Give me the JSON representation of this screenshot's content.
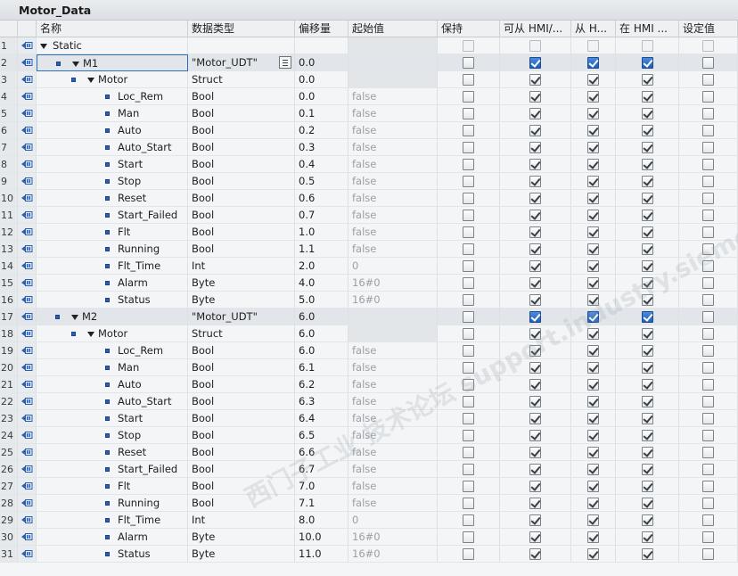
{
  "window": {
    "title": "Motor_Data"
  },
  "columns": [
    "名称",
    "数据类型",
    "偏移量",
    "起始值",
    "保持",
    "可从 HMI/...",
    "从 H...",
    "在 HMI ...",
    "设定值"
  ],
  "rows": [
    {
      "num": "1",
      "level": 0,
      "expand": true,
      "dot": false,
      "name": "Static",
      "type": "",
      "offset": "",
      "start": "",
      "hmi": "faded",
      "retain": "faded",
      "ellip": false
    },
    {
      "num": "2",
      "level": 1,
      "expand": true,
      "dot": true,
      "name": "M1",
      "type": "\"Motor_UDT\"",
      "offset": "0.0",
      "start": "",
      "hmi": "blue",
      "selected": true,
      "ellip": true
    },
    {
      "num": "3",
      "level": 2,
      "expand": true,
      "dot": true,
      "name": "Motor",
      "type": "Struct",
      "offset": "0.0",
      "start": "",
      "hmi": "on"
    },
    {
      "num": "4",
      "level": 3,
      "dot": true,
      "name": "Loc_Rem",
      "type": "Bool",
      "offset": "0.0",
      "start": "false",
      "hmi": "on"
    },
    {
      "num": "5",
      "level": 3,
      "dot": true,
      "name": "Man",
      "type": "Bool",
      "offset": "0.1",
      "start": "false",
      "hmi": "on"
    },
    {
      "num": "6",
      "level": 3,
      "dot": true,
      "name": "Auto",
      "type": "Bool",
      "offset": "0.2",
      "start": "false",
      "hmi": "on"
    },
    {
      "num": "7",
      "level": 3,
      "dot": true,
      "name": "Auto_Start",
      "type": "Bool",
      "offset": "0.3",
      "start": "false",
      "hmi": "on"
    },
    {
      "num": "8",
      "level": 3,
      "dot": true,
      "name": "Start",
      "type": "Bool",
      "offset": "0.4",
      "start": "false",
      "hmi": "on"
    },
    {
      "num": "9",
      "level": 3,
      "dot": true,
      "name": "Stop",
      "type": "Bool",
      "offset": "0.5",
      "start": "false",
      "hmi": "on"
    },
    {
      "num": "10",
      "level": 3,
      "dot": true,
      "name": "Reset",
      "type": "Bool",
      "offset": "0.6",
      "start": "false",
      "hmi": "on"
    },
    {
      "num": "11",
      "level": 3,
      "dot": true,
      "name": "Start_Failed",
      "type": "Bool",
      "offset": "0.7",
      "start": "false",
      "hmi": "on"
    },
    {
      "num": "12",
      "level": 3,
      "dot": true,
      "name": "Flt",
      "type": "Bool",
      "offset": "1.0",
      "start": "false",
      "hmi": "on"
    },
    {
      "num": "13",
      "level": 3,
      "dot": true,
      "name": "Running",
      "type": "Bool",
      "offset": "1.1",
      "start": "false",
      "hmi": "on"
    },
    {
      "num": "14",
      "level": 3,
      "dot": true,
      "name": "Flt_Time",
      "type": "Int",
      "offset": "2.0",
      "start": "0",
      "hmi": "on"
    },
    {
      "num": "15",
      "level": 3,
      "dot": true,
      "name": "Alarm",
      "type": "Byte",
      "offset": "4.0",
      "start": "16#0",
      "hmi": "on"
    },
    {
      "num": "16",
      "level": 3,
      "dot": true,
      "name": "Status",
      "type": "Byte",
      "offset": "5.0",
      "start": "16#0",
      "hmi": "on"
    },
    {
      "num": "17",
      "level": 1,
      "expand": true,
      "dot": true,
      "name": "M2",
      "type": "\"Motor_UDT\"",
      "offset": "6.0",
      "start": "",
      "hmi": "blue",
      "selected": true
    },
    {
      "num": "18",
      "level": 2,
      "expand": true,
      "dot": true,
      "name": "Motor",
      "type": "Struct",
      "offset": "6.0",
      "start": "",
      "hmi": "on"
    },
    {
      "num": "19",
      "level": 3,
      "dot": true,
      "name": "Loc_Rem",
      "type": "Bool",
      "offset": "6.0",
      "start": "false",
      "hmi": "on"
    },
    {
      "num": "20",
      "level": 3,
      "dot": true,
      "name": "Man",
      "type": "Bool",
      "offset": "6.1",
      "start": "false",
      "hmi": "on"
    },
    {
      "num": "21",
      "level": 3,
      "dot": true,
      "name": "Auto",
      "type": "Bool",
      "offset": "6.2",
      "start": "false",
      "hmi": "on"
    },
    {
      "num": "22",
      "level": 3,
      "dot": true,
      "name": "Auto_Start",
      "type": "Bool",
      "offset": "6.3",
      "start": "false",
      "hmi": "on"
    },
    {
      "num": "23",
      "level": 3,
      "dot": true,
      "name": "Start",
      "type": "Bool",
      "offset": "6.4",
      "start": "false",
      "hmi": "on"
    },
    {
      "num": "24",
      "level": 3,
      "dot": true,
      "name": "Stop",
      "type": "Bool",
      "offset": "6.5",
      "start": "false",
      "hmi": "on"
    },
    {
      "num": "25",
      "level": 3,
      "dot": true,
      "name": "Reset",
      "type": "Bool",
      "offset": "6.6",
      "start": "false",
      "hmi": "on"
    },
    {
      "num": "26",
      "level": 3,
      "dot": true,
      "name": "Start_Failed",
      "type": "Bool",
      "offset": "6.7",
      "start": "false",
      "hmi": "on"
    },
    {
      "num": "27",
      "level": 3,
      "dot": true,
      "name": "Flt",
      "type": "Bool",
      "offset": "7.0",
      "start": "false",
      "hmi": "on"
    },
    {
      "num": "28",
      "level": 3,
      "dot": true,
      "name": "Running",
      "type": "Bool",
      "offset": "7.1",
      "start": "false",
      "hmi": "on"
    },
    {
      "num": "29",
      "level": 3,
      "dot": true,
      "name": "Flt_Time",
      "type": "Int",
      "offset": "8.0",
      "start": "0",
      "hmi": "on"
    },
    {
      "num": "30",
      "level": 3,
      "dot": true,
      "name": "Alarm",
      "type": "Byte",
      "offset": "10.0",
      "start": "16#0",
      "hmi": "on"
    },
    {
      "num": "31",
      "level": 3,
      "dot": true,
      "name": "Status",
      "type": "Byte",
      "offset": "11.0",
      "start": "16#0",
      "hmi": "on"
    }
  ],
  "watermark": "西门子工业 技术论坛 support.industry.siemens.com/cs",
  "colors": {
    "checkbox_selected": "#1f5fb8",
    "start_value_text": "#9aa0a6",
    "selection_border": "#2b6fb7"
  },
  "icons": {
    "row_icon": "db-tag-icon",
    "expand": "triangle-down-icon",
    "member_marker": "square-dot-icon",
    "ellipsis": "list-browse-icon"
  }
}
